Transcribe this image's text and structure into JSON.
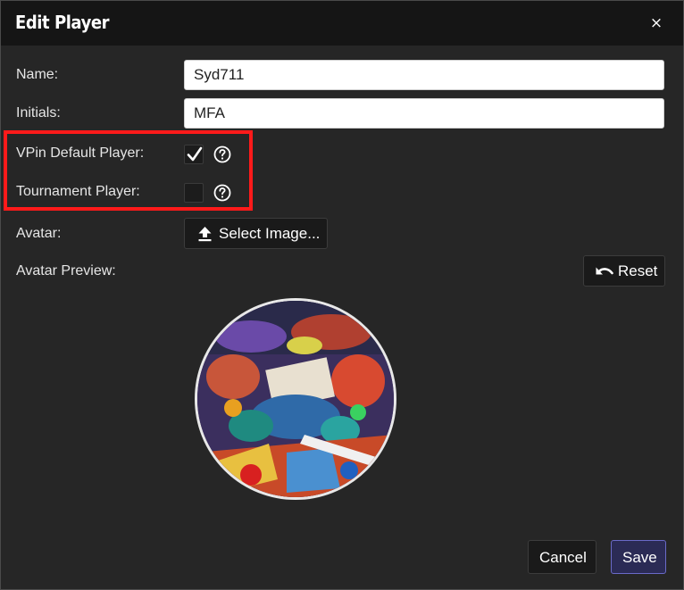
{
  "dialog": {
    "title": "Edit Player",
    "close_icon": "×"
  },
  "form": {
    "name_label": "Name:",
    "name_value": "Syd711",
    "initials_label": "Initials:",
    "initials_value": "MFA",
    "vpin_default_label": "VPin Default Player:",
    "vpin_default_checked": true,
    "tournament_label": "Tournament Player:",
    "tournament_checked": false,
    "avatar_label": "Avatar:",
    "select_image_label": "Select Image...",
    "avatar_preview_label": "Avatar Preview:",
    "reset_label": "Reset"
  },
  "footer": {
    "cancel_label": "Cancel",
    "save_label": "Save"
  },
  "icons": {
    "help": "help-circle-icon",
    "upload": "upload-icon",
    "undo": "undo-icon",
    "check": "checkmark-icon"
  },
  "colors": {
    "highlight": "#ff1a1a",
    "save_border": "#6a6ac8",
    "background": "#262626",
    "titlebar": "#151515"
  }
}
